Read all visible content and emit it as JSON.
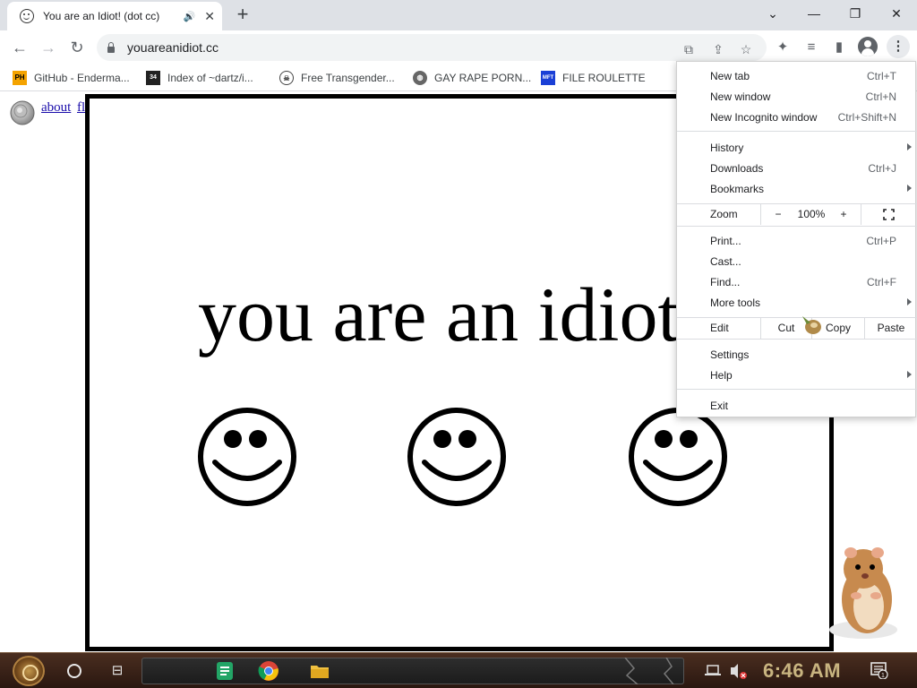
{
  "browser": {
    "tab": {
      "title": "You are an Idiot! (dot cc)",
      "close": "✕"
    },
    "new_tab": "+",
    "window_controls": {
      "search_tabs": "⌄",
      "minimize": "—",
      "restore": "❐",
      "close": "✕"
    },
    "nav": {
      "back": "←",
      "forward": "→",
      "reload": "↻"
    },
    "address_bar": {
      "url": "youareanidiot.cc"
    },
    "menu_button": "⋮"
  },
  "bookmarks": [
    {
      "label": "GitHub - Enderma...",
      "icon": "pornhub-icon",
      "badge": "PH"
    },
    {
      "label": "Index of ~dartz/i...",
      "icon": "dartz-icon",
      "badge": "34"
    },
    {
      "label": "Free Transgender...",
      "icon": "skull-icon",
      "badge": ""
    },
    {
      "label": "GAY RAPE PORN...",
      "icon": "globe-icon",
      "badge": ""
    },
    {
      "label": "FILE ROULETTE",
      "icon": "file-roulette-icon",
      "badge": "MFT"
    }
  ],
  "page": {
    "about_link": "about",
    "flash_link": "flash",
    "headline": "you are an idiot"
  },
  "menu": {
    "new_tab": {
      "label": "New tab",
      "shortcut": "Ctrl+T"
    },
    "new_window": {
      "label": "New window",
      "shortcut": "Ctrl+N"
    },
    "new_incognito": {
      "label": "New Incognito window",
      "shortcut": "Ctrl+Shift+N"
    },
    "history": {
      "label": "History"
    },
    "downloads": {
      "label": "Downloads",
      "shortcut": "Ctrl+J"
    },
    "bookmarks": {
      "label": "Bookmarks"
    },
    "zoom": {
      "label": "Zoom",
      "minus": "−",
      "value": "100%",
      "plus": "+"
    },
    "print": {
      "label": "Print...",
      "shortcut": "Ctrl+P"
    },
    "cast": {
      "label": "Cast..."
    },
    "find": {
      "label": "Find...",
      "shortcut": "Ctrl+F"
    },
    "more_tools": {
      "label": "More tools"
    },
    "edit": {
      "label": "Edit",
      "cut": "Cut",
      "copy": "Copy",
      "paste": "Paste"
    },
    "settings": {
      "label": "Settings"
    },
    "help": {
      "label": "Help"
    },
    "exit": {
      "label": "Exit"
    }
  },
  "taskbar": {
    "clock": "6:46 AM",
    "notification_count": "1"
  },
  "colors": {
    "tab_strip": "#dee1e6",
    "link": "#1a0dab",
    "taskbar": "#3a2216",
    "clock": "#c8b480"
  }
}
